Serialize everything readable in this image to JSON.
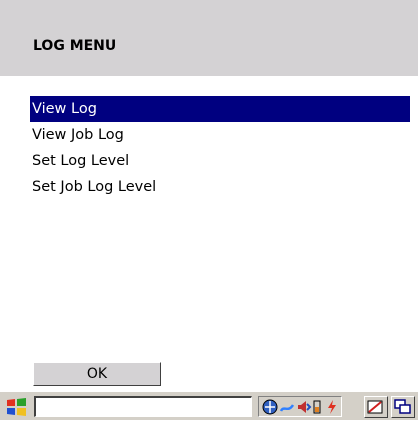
{
  "header": {
    "title": "LOG MENU"
  },
  "menu": {
    "items": [
      {
        "label": "View Log",
        "selected": true
      },
      {
        "label": "View Job Log",
        "selected": false
      },
      {
        "label": "Set Log Level",
        "selected": false
      },
      {
        "label": "Set Job Log Level",
        "selected": false
      }
    ]
  },
  "footer": {
    "ok_label": "OK"
  },
  "taskbar": {
    "start_icon": "windows-flag-icon",
    "tray_icons": [
      "network-icon",
      "connection-icon",
      "volume-icon",
      "battery-icon",
      "power-icon"
    ],
    "buttons": [
      "input-panel-icon",
      "switch-window-icon"
    ]
  },
  "colors": {
    "title_bar": "#d4d2d4",
    "selection": "#000080",
    "taskbar": "#d4d0c8"
  }
}
